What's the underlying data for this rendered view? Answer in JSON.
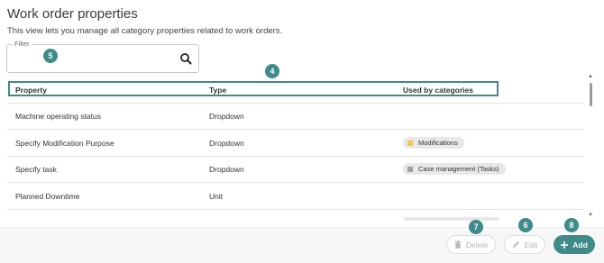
{
  "page": {
    "title": "Work order properties",
    "subtitle": "This view lets you manage all category properties related to work orders."
  },
  "filter": {
    "label": "Filter",
    "value": ""
  },
  "callouts": {
    "filter": "5",
    "header": "4",
    "edit": "6",
    "delete": "7",
    "add": "8"
  },
  "table": {
    "headers": {
      "property": "Property",
      "type": "Type",
      "used_by": "Used by categories"
    },
    "rows": [
      {
        "property": "Machine operating status",
        "type": "Dropdown",
        "tag": "",
        "tag_color": ""
      },
      {
        "property": "Specify Modification Purpose",
        "type": "Dropdown",
        "tag": "Modifications",
        "tag_color": "#f2c94c"
      },
      {
        "property": "Specify task",
        "type": "Dropdown",
        "tag": "Case management (Tasks)",
        "tag_color": "#9e9e9e"
      },
      {
        "property": "Planned Downtime",
        "type": "Unit",
        "tag": "",
        "tag_color": ""
      }
    ]
  },
  "actions": {
    "delete_label": "Delete",
    "edit_label": "Edit",
    "add_label": "Add"
  },
  "colors": {
    "accent": "#3f8a8a",
    "modifications_tag": "#f2c94c",
    "case_management_tag": "#9e9e9e"
  },
  "icons": {
    "filter": "search-icon",
    "delete": "trash-icon",
    "edit": "pencil-icon",
    "add": "plus-icon"
  }
}
